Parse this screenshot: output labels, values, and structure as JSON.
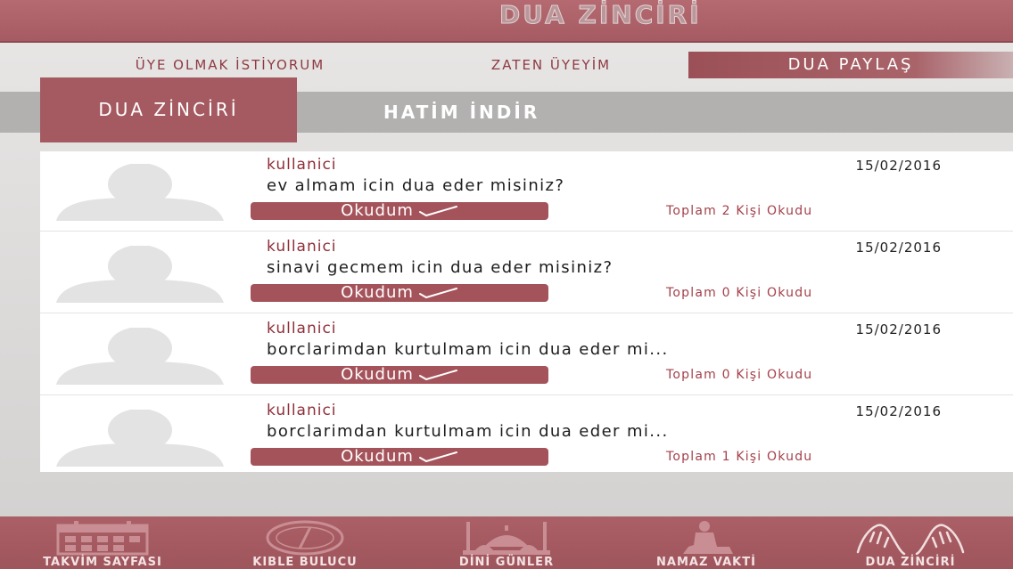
{
  "header": {
    "title": "DUA ZİNCİRİ"
  },
  "topnav": {
    "items": [
      {
        "label": "ÜYE OLMAK İSTİYORUM"
      },
      {
        "label": "ZATEN ÜYEYİM"
      },
      {
        "label": "DUA PAYLAŞ",
        "active": true
      }
    ]
  },
  "tabs": [
    {
      "label": "DUA ZİNCİRİ",
      "active": true
    },
    {
      "label": "HATİM İNDİR"
    }
  ],
  "posts": [
    {
      "user": "kullanici",
      "date": "15/02/2016",
      "message": "ev almam icin dua eder misiniz?",
      "button": "Okudum",
      "total": "Toplam 2 Kişi Okudu"
    },
    {
      "user": "kullanici",
      "date": "15/02/2016",
      "message": "sinavi gecmem icin dua eder misiniz?",
      "button": "Okudum",
      "total": "Toplam 0 Kişi Okudu"
    },
    {
      "user": "kullanici",
      "date": "15/02/2016",
      "message": "borclarimdan kurtulmam icin dua eder mi...",
      "button": "Okudum",
      "total": "Toplam 0 Kişi Okudu"
    },
    {
      "user": "kullanici",
      "date": "15/02/2016",
      "message": "borclarimdan kurtulmam icin dua eder mi...",
      "button": "Okudum",
      "total": "Toplam 1 Kişi Okudu"
    }
  ],
  "bottom_nav": [
    {
      "label": "TAKVİM SAYFASI",
      "icon": "calendar-icon"
    },
    {
      "label": "KIBLE BULUCU",
      "icon": "compass-icon"
    },
    {
      "label": "DİNİ GÜNLER",
      "icon": "mosque-icon"
    },
    {
      "label": "NAMAZ VAKTİ",
      "icon": "praying-person-icon"
    },
    {
      "label": "DUA ZİNCİRİ",
      "icon": "praying-hands-icon"
    }
  ],
  "colors": {
    "accent": "#a55a61",
    "header": "#ab6068",
    "text_accent": "#8e2f38"
  }
}
